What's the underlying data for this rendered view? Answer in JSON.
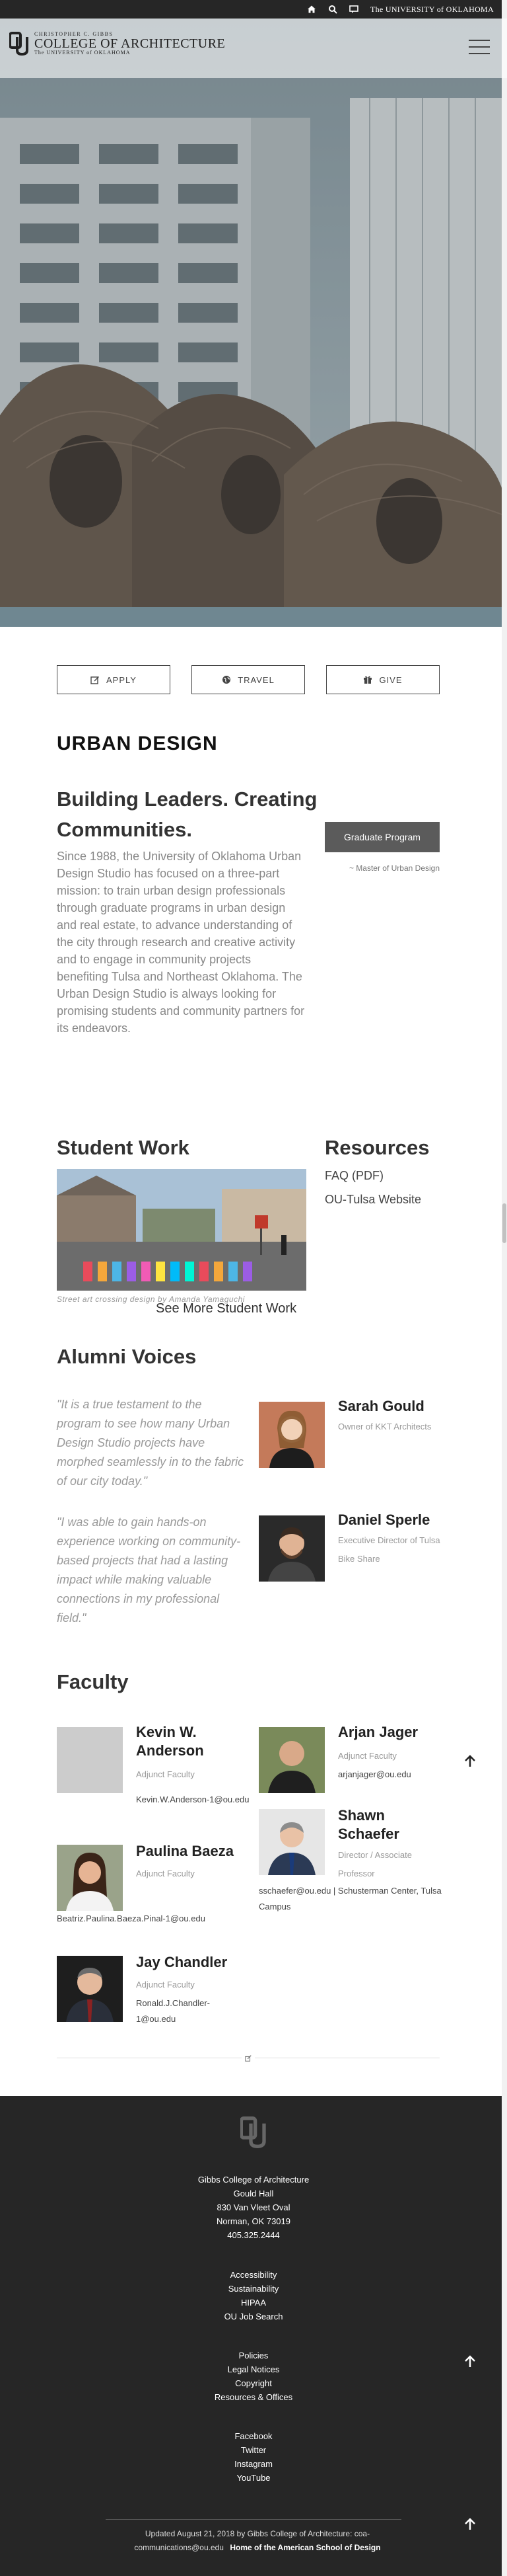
{
  "topbar": {
    "home_icon": "home-icon",
    "search_icon": "search-icon",
    "chat_icon": "chat-icon",
    "university_label": "The UNIVERSITY of OKLAHOMA"
  },
  "header": {
    "logo_line1": "CHRISTOPHER C. GIBBS",
    "logo_line2": "COLLEGE OF ARCHITECTURE",
    "logo_line3": "The UNIVERSITY of OKLAHOMA",
    "menu_icon": "hamburger-menu-icon"
  },
  "actions": [
    {
      "label": "APPLY",
      "icon": "edit-icon"
    },
    {
      "label": "TRAVEL",
      "icon": "globe-icon"
    },
    {
      "label": "GIVE",
      "icon": "gift-icon"
    }
  ],
  "page_title": "URBAN DESIGN",
  "intro": {
    "heading": "Building Leaders. Creating Communities.",
    "body": "Since 1988, the University of Oklahoma Urban Design Studio has focused on a three-part mission: to train urban design professionals through graduate programs in urban design and real estate, to advance understanding of the city through research and creative activity and to engage in community projects benefiting Tulsa and Northeast Oklahoma. The Urban Design Studio is always looking for promising students and community partners for its endeavors.",
    "program_button": "Graduate Program",
    "program_sub": "~ Master of Urban Design"
  },
  "student_work": {
    "heading": "Student Work",
    "caption": "Street art crossing design by Amanda Yamaguchi",
    "see_more": "See More Student Work"
  },
  "resources": {
    "heading": "Resources",
    "links": [
      "FAQ (PDF)",
      "OU-Tulsa Website"
    ]
  },
  "alumni": {
    "heading": "Alumni Voices",
    "items": [
      {
        "quote": "\"It is a true testament to the program to see how many Urban Design Studio projects have morphed seamlessly in to the fabric of our city today.\"",
        "name": "Sarah Gould",
        "role": "Owner of KKT Architects"
      },
      {
        "quote": "\"I was able to gain hands-on experience working on community-based projects that had a lasting impact while making valuable connections in my professional field.\"",
        "name": "Daniel Sperle",
        "role": "Executive Director of Tulsa Bike Share"
      }
    ]
  },
  "faculty": {
    "heading": "Faculty",
    "members": [
      {
        "name": "Kevin W. Anderson",
        "role": "Adjunct Faculty",
        "email": "Kevin.W.Anderson-1@ou.edu"
      },
      {
        "name": "Arjan Jager",
        "role": "Adjunct Faculty",
        "email": "arjanjager@ou.edu"
      },
      {
        "name": "Shawn Schaefer",
        "role": "Director / Associate Professor",
        "email": "sschaefer@ou.edu | Schusterman Center, Tulsa Campus"
      },
      {
        "name": "Paulina Baeza",
        "role": "Adjunct Faculty",
        "email": "Beatriz.Paulina.Baeza.Pinal-1@ou.edu"
      },
      {
        "name": "Jay Chandler",
        "role": "Adjunct Faculty",
        "email": "Ronald.J.Chandler-1@ou.edu"
      }
    ]
  },
  "footer": {
    "address": [
      "Gibbs College of Architecture",
      "Gould Hall",
      "830 Van Vleet Oval",
      "Norman, OK 73019",
      "405.325.2444"
    ],
    "links1": [
      "Accessibility",
      "Sustainability",
      "HIPAA",
      "OU Job Search"
    ],
    "links2": [
      "Policies",
      "Legal Notices",
      "Copyright",
      "Resources & Offices"
    ],
    "social": [
      "Facebook",
      "Twitter",
      "Instagram",
      "YouTube"
    ],
    "updated": "Updated August 21, 2018 by Gibbs College of Architecture: coa-communications@ou.edu",
    "tagline": "Home of the American School of Design"
  },
  "colors": {
    "dark": "#262626",
    "button_gray": "#5b5b5b",
    "hero_stripe": "#6f8791"
  }
}
